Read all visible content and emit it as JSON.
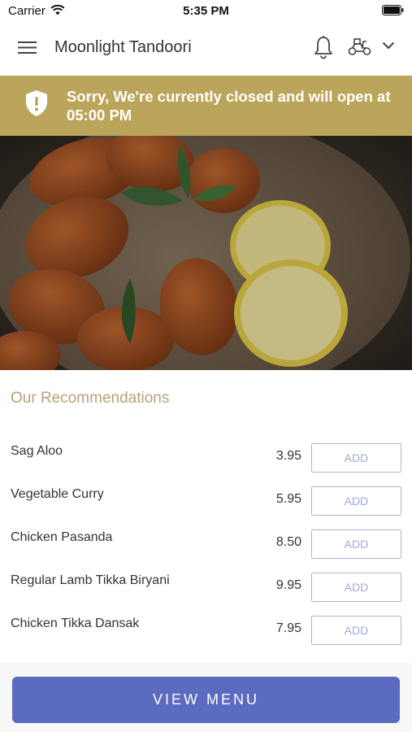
{
  "status_bar": {
    "carrier": "Carrier",
    "time": "5:35 PM"
  },
  "header": {
    "title": "Moonlight Tandoori",
    "icons": [
      "menu-icon",
      "bell-icon",
      "delivery-scooter-icon",
      "chevron-down-icon"
    ]
  },
  "banner": {
    "text": "Sorry, We're currently closed and will open at 05:00 PM",
    "icon": "shield-alert-icon",
    "color": "#bba55a"
  },
  "hero": {
    "description": "food photo"
  },
  "recommendations": {
    "title": "Our Recommendations",
    "add_label": "ADD",
    "items": [
      {
        "name": "Sag Aloo",
        "price": "3.95"
      },
      {
        "name": "Vegetable Curry",
        "price": "5.95"
      },
      {
        "name": "Chicken Pasanda",
        "price": "8.50"
      },
      {
        "name": "Regular Lamb Tikka Biryani",
        "price": "9.95"
      },
      {
        "name": "Chicken Tikka Dansak",
        "price": "7.95"
      }
    ]
  },
  "footer": {
    "view_menu_label": "VIEW MENU",
    "accent": "#5b6bbf"
  }
}
